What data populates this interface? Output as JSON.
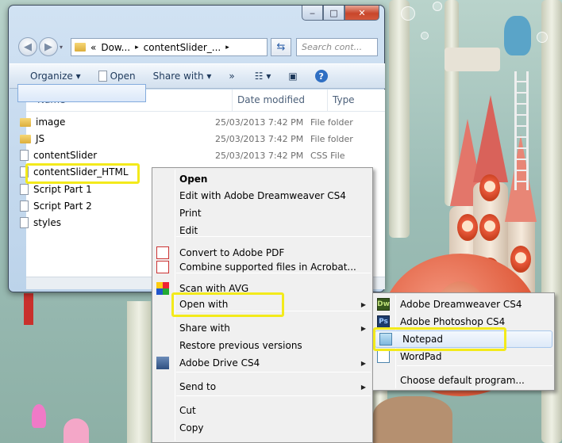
{
  "window": {
    "title_buttons": {
      "minimize": "‒",
      "maximize": "□",
      "close": "✕"
    },
    "address_parts": [
      "«",
      "Dow...",
      "▸",
      "contentSlider_...",
      "▸"
    ],
    "search_placeholder": "Search cont...",
    "toolbar": {
      "organize": "Organize ▾",
      "open": "Open",
      "share_with": "Share with ▾",
      "more": "»"
    },
    "columns": {
      "name": "Name",
      "date": "Date modified",
      "type": "Type"
    },
    "files": [
      {
        "name": "image",
        "date": "25/03/2013 7:42 PM",
        "type": "File folder",
        "icon": "folder-icon"
      },
      {
        "name": "JS",
        "date": "25/03/2013 7:42 PM",
        "type": "File folder",
        "icon": "folder-icon"
      },
      {
        "name": "contentSlider",
        "date": "25/03/2013 7:42 PM",
        "type": "CSS File",
        "icon": "file-icon"
      },
      {
        "name": "contentSlider_HTML",
        "date": "",
        "type": "",
        "icon": "file-icon"
      },
      {
        "name": "Script Part 1",
        "date": "",
        "type": "",
        "icon": "file-icon"
      },
      {
        "name": "Script Part 2",
        "date": "",
        "type": "",
        "icon": "file-icon"
      },
      {
        "name": "styles",
        "date": "",
        "type": "",
        "icon": "file-icon"
      }
    ]
  },
  "context_menu": {
    "items": [
      {
        "label": "Open",
        "bold": true
      },
      {
        "label": "Edit with Adobe Dreamweaver CS4"
      },
      {
        "label": "Print"
      },
      {
        "label": "Edit"
      },
      {
        "label": "Convert to Adobe PDF",
        "icon": "pdf-icon"
      },
      {
        "label": "Combine supported files in Acrobat...",
        "icon": "acrobat-icon"
      },
      {
        "label": "Scan with AVG",
        "icon": "avg-icon"
      },
      {
        "label": "Open with",
        "submenu": true
      },
      {
        "label": "Share with",
        "submenu": true
      },
      {
        "label": "Restore previous versions"
      },
      {
        "label": "Adobe Drive CS4",
        "icon": "adobe-drive-icon",
        "submenu": true
      },
      {
        "label": "Send to",
        "submenu": true
      },
      {
        "label": "Cut"
      },
      {
        "label": "Copy"
      }
    ]
  },
  "submenu": {
    "items": [
      {
        "label": "Adobe Dreamweaver CS4",
        "icon": "dreamweaver-icon",
        "badge": "Dw"
      },
      {
        "label": "Adobe Photoshop CS4",
        "icon": "photoshop-icon",
        "badge": "Ps"
      },
      {
        "label": "Notepad",
        "icon": "notepad-icon"
      },
      {
        "label": "WordPad",
        "icon": "wordpad-icon"
      },
      {
        "label": "Choose default program..."
      }
    ]
  },
  "colors": {
    "highlight": "#f3ea1b",
    "selection": "#dbe8f9",
    "menu_bg": "#f0f0f0"
  }
}
